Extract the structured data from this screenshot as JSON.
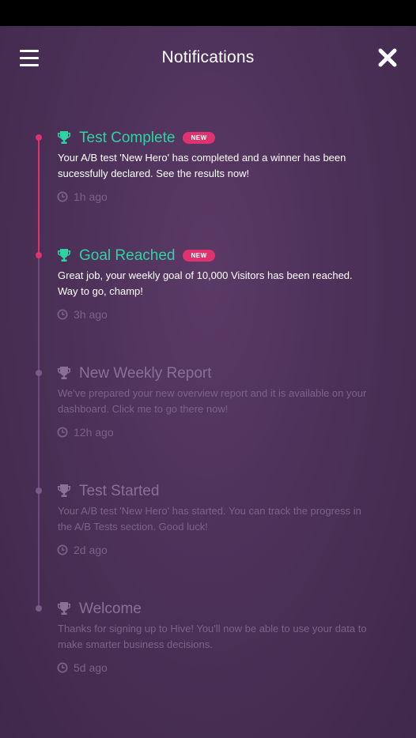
{
  "header": {
    "title": "Notifications"
  },
  "notifications": [
    {
      "title": "Test Complete",
      "badge": "NEW",
      "text": "Your A/B test 'New Hero' has completed and a winner has been sucessfully declared. See the results now!",
      "time": "1h ago",
      "unread": true
    },
    {
      "title": "Goal Reached",
      "badge": "NEW",
      "text": "Great job, your weekly goal of 10,000 Visitors has been reached. Way to go, champ!",
      "time": "3h ago",
      "unread": true
    },
    {
      "title": "New Weekly Report",
      "text": "We've prepared your new overview report and it is available on your dashboard. Click me to go there now!",
      "time": "12h ago",
      "unread": false
    },
    {
      "title": "Test Started",
      "text": "Your A/B test 'New Hero' has started. You can track the progress in the A/B Tests section. Good luck!",
      "time": "2d ago",
      "unread": false
    },
    {
      "title": "Welcome",
      "text": "Thanks for signing up to Hive! You'll now be able to use your data to make smarter business decisions.",
      "time": "5d ago",
      "unread": false
    }
  ],
  "colors": {
    "accent_green": "#2ed3a3",
    "accent_pink": "#e0326e",
    "background": "#4d3159"
  },
  "icons": [
    "menu-icon",
    "close-icon",
    "trophy-icon",
    "clock-icon"
  ]
}
